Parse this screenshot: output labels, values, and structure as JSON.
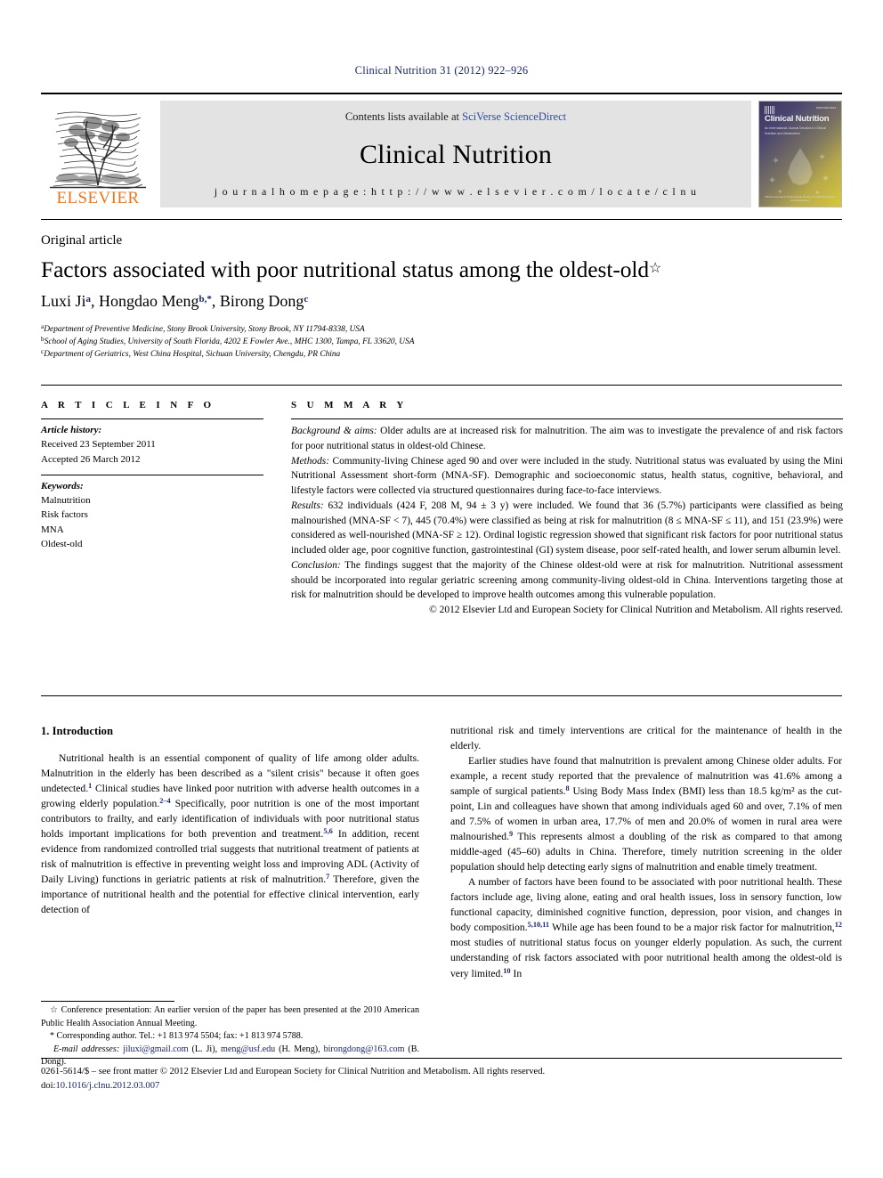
{
  "running_head": "Clinical Nutrition 31 (2012) 922–926",
  "masthead": {
    "publisher_name": "ELSEVIER",
    "contents_prefix": "Contents lists available at ",
    "contents_link": "SciVerse ScienceDirect",
    "journal_name": "Clinical Nutrition",
    "homepage_label": "j o u r n a l   h o m e p a g e :   h t t p : / / w w w . e l s e v i e r . c o m / l o c a t e / c l n u",
    "cover": {
      "title": "Clinical Nutrition",
      "subtitle": "An International Journal Devoted to Clinical Nutrition and Metabolism",
      "issn": "ISSN 0261-5614",
      "footer": "Official Journal of the European Society for Clinical Nutrition and Metabolism"
    }
  },
  "article": {
    "kind": "Original article",
    "title": "Factors associated with poor nutritional status among the oldest-old",
    "title_dagger": "☆",
    "authors": [
      {
        "name": "Luxi Ji",
        "sup": "a"
      },
      {
        "name": "Hongdao Meng",
        "sup": "b,*"
      },
      {
        "name": "Birong Dong",
        "sup": "c"
      }
    ],
    "authors_line": "Luxi Ji a, Hongdao Meng b,*, Birong Dong c",
    "affiliations": [
      {
        "mark": "a",
        "text": "Department of Preventive Medicine, Stony Brook University, Stony Brook, NY 11794-8338, USA"
      },
      {
        "mark": "b",
        "text": "School of Aging Studies, University of South Florida, 4202 E Fowler Ave., MHC 1300, Tampa, FL 33620, USA"
      },
      {
        "mark": "c",
        "text": "Department of Geriatrics, West China Hospital, Sichuan University, Chengdu, PR China"
      }
    ]
  },
  "article_info": {
    "heading": "A R T I C L E   I N F O",
    "history_label": "Article history:",
    "history": [
      "Received 23 September 2011",
      "Accepted 26 March 2012"
    ],
    "keywords_label": "Keywords:",
    "keywords": [
      "Malnutrition",
      "Risk factors",
      "MNA",
      "Oldest-old"
    ]
  },
  "summary": {
    "heading": "S U M M A R Y",
    "sections": [
      {
        "label": "Background & aims:",
        "text": " Older adults are at increased risk for malnutrition. The aim was to investigate the prevalence of and risk factors for poor nutritional status in oldest-old Chinese."
      },
      {
        "label": "Methods:",
        "text": " Community-living Chinese aged 90 and over were included in the study. Nutritional status was evaluated by using the Mini Nutritional Assessment short-form (MNA-SF). Demographic and socioeconomic status, health status, cognitive, behavioral, and lifestyle factors were collected via structured questionnaires during face-to-face interviews."
      },
      {
        "label": "Results:",
        "text": " 632 individuals (424 F, 208 M, 94 ± 3 y) were included. We found that 36 (5.7%) participants were classified as being malnourished (MNA-SF < 7), 445 (70.4%) were classified as being at risk for malnutrition (8 ≤ MNA-SF ≤ 11), and 151 (23.9%) were considered as well-nourished (MNA-SF ≥ 12). Ordinal logistic regression showed that significant risk factors for poor nutritional status included older age, poor cognitive function, gastrointestinal (GI) system disease, poor self-rated health, and lower serum albumin level."
      },
      {
        "label": "Conclusion:",
        "text": " The findings suggest that the majority of the Chinese oldest-old were at risk for malnutrition. Nutritional assessment should be incorporated into regular geriatric screening among community-living oldest-old in China. Interventions targeting those at risk for malnutrition should be developed to improve health outcomes among this vulnerable population."
      }
    ],
    "copyright": "© 2012 Elsevier Ltd and European Society for Clinical Nutrition and Metabolism. All rights reserved."
  },
  "body": {
    "section_number_title": "1. Introduction",
    "left_paragraphs": [
      "Nutritional health is an essential component of quality of life among older adults. Malnutrition in the elderly has been described as a \"silent crisis\" because it often goes undetected.",
      "Clinical studies have linked poor nutrition with adverse health outcomes in a growing elderly population.",
      "Specifically, poor nutrition is one of the most important contributors to frailty, and early identification of individuals with poor nutritional status holds important implications for both prevention and treatment.",
      "In addition, recent evidence from randomized controlled trial suggests that nutritional treatment of patients at risk of malnutrition is effective in preventing weight loss and improving ADL (Activity of Daily Living) functions in geriatric patients at risk of malnutrition.",
      "Therefore, given the importance of nutritional health and the potential for effective clinical intervention, early detection of"
    ],
    "left_refs": [
      "1",
      "2–4",
      "5,6",
      "7"
    ],
    "right_paragraphs": [
      "nutritional risk and timely interventions are critical for the maintenance of health in the elderly.",
      "Earlier studies have found that malnutrition is prevalent among Chinese older adults. For example, a recent study reported that the prevalence of malnutrition was 41.6% among a sample of surgical patients.",
      "Using Body Mass Index (BMI) less than 18.5 kg/m² as the cut-point, Lin and colleagues have shown that among individuals aged 60 and over, 7.1% of men and 7.5% of women in urban area, 17.7% of men and 20.0% of women in rural area were malnourished.",
      "This represents almost a doubling of the risk as compared to that among middle-aged (45–60) adults in China. Therefore, timely nutrition screening in the older population should help detecting early signs of malnutrition and enable timely treatment.",
      "A number of factors have been found to be associated with poor nutritional health. These factors include age, living alone, eating and oral health issues, loss in sensory function, low functional capacity, diminished cognitive function, depression, poor vision, and changes in body composition.",
      "While age has been found to be a major risk factor for malnutrition,",
      "most studies of nutritional status focus on younger elderly population. As such, the current understanding of risk factors associated with poor nutritional health among the oldest-old is very limited.",
      "In"
    ],
    "right_refs": [
      "8",
      "9",
      "5,10,11",
      "12",
      "10"
    ]
  },
  "footnotes": {
    "conference_mark": "☆",
    "conference": " Conference presentation: An earlier version of the paper has been presented at the 2010 American Public Health Association Annual Meeting.",
    "corresponding_mark": "*",
    "corresponding": " Corresponding author. Tel.: +1 813 974 5504; fax: +1 813 974 5788.",
    "email_label": "E-mail addresses:",
    "emails": [
      {
        "address": "jiluxi@gmail.com",
        "owner": "(L. Ji)"
      },
      {
        "address": "meng@usf.edu",
        "owner": "(H. Meng)"
      },
      {
        "address": "birongdong@163.com",
        "owner": "(B. Dong)"
      }
    ]
  },
  "imprint": {
    "line1": "0261-5614/$ – see front matter © 2012 Elsevier Ltd and European Society for Clinical Nutrition and Metabolism. All rights reserved.",
    "doi_label": "doi:",
    "doi": "10.1016/j.clnu.2012.03.007"
  },
  "colors": {
    "link": "#17256b",
    "elsevier_orange": "#e87722",
    "masthead_bg": "#e3e3e3"
  }
}
